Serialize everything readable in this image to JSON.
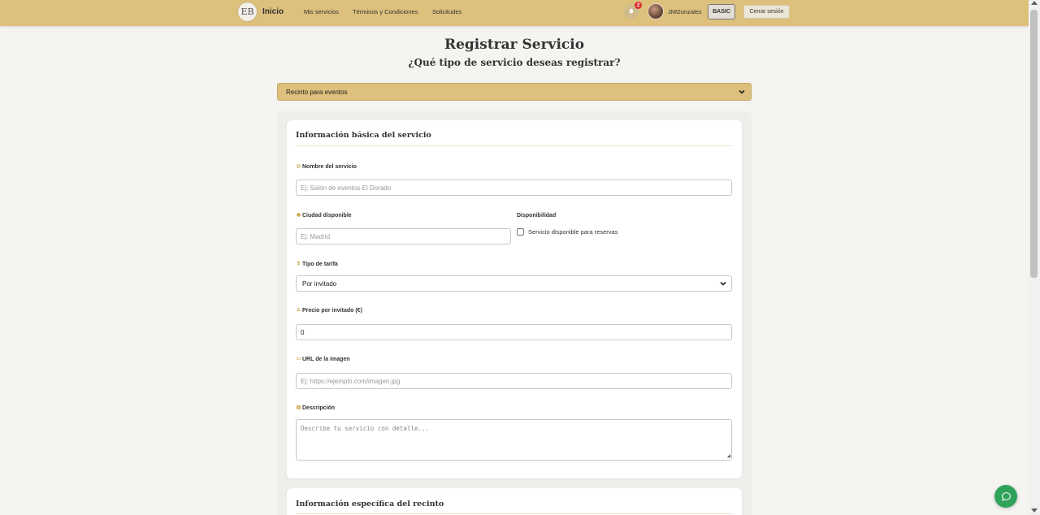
{
  "nav": {
    "logo_text": "EB",
    "brand": "Inicio",
    "links": [
      "Mis servicios",
      "Términos y Condiciones",
      "Solicitudes"
    ],
    "notifications_count": "2",
    "username": "JMGonzalez",
    "plan": "BASIC",
    "logout": "Cerrar sesión"
  },
  "page": {
    "title": "Registrar Servicio",
    "subtitle": "¿Qué tipo de servicio deseas registrar?",
    "service_type": "Recinto para eventos"
  },
  "basic_info": {
    "title": "Información básica del servicio",
    "name": {
      "label": "Nombre del servicio",
      "placeholder": "Ej: Salón de eventos El Dorado"
    },
    "city": {
      "label": "Ciudad disponible",
      "placeholder": "Ej: Madrid"
    },
    "availability": {
      "label": "Disponibilidad",
      "checkbox_label": "Servicio disponible para reservas"
    },
    "rate_type": {
      "label": "Tipo de tarifa",
      "value": "Por invitado"
    },
    "price": {
      "label": "Precio por invitado (€)",
      "value": "0"
    },
    "image_url": {
      "label": "URL de la imagen",
      "placeholder": "Ej: https://ejemplo.com/imagen.jpg"
    },
    "description": {
      "label": "Descripción",
      "placeholder": "Describe tu servicio con detalle..."
    }
  },
  "venue_info": {
    "title": "Información específica del recinto"
  },
  "colors": {
    "accent": "#dcc07c",
    "chat_button": "#2fa35a",
    "badge": "#d93030"
  },
  "icons": {
    "chat": "chat-bubble-icon",
    "bell": "bell-icon",
    "chevron": "chevron-down-icon"
  }
}
